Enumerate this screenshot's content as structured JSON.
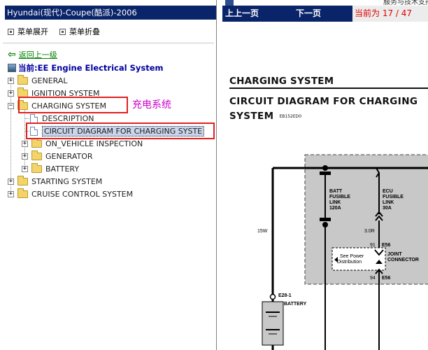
{
  "window": {
    "title": "Hyundai(现代)-Coupe(酷派)-2006"
  },
  "menu": {
    "expand_label": "菜单展开",
    "collapse_label": "菜单折叠"
  },
  "back_link": "返回上一级",
  "current_path": "当前:EE Engine Electrical System",
  "tree": {
    "general": "GENERAL",
    "ignition": "IGNITION SYSTEM",
    "charging": "CHARGING SYSTEM",
    "description": "DESCRIPTION",
    "circuit": "CIRCUIT DIAGRAM FOR CHARGING SYSTE",
    "onvehicle": "ON_VEHICLE INSPECTION",
    "generator": "GENERATOR",
    "battery": "BATTERY",
    "starting": "STARTING SYSTEM",
    "cruise": "CRUISE CONTROL SYSTEM",
    "expander_plus": "+",
    "expander_minus": "−"
  },
  "annotation": "充电系统",
  "top_band_text": "服务与技术支持中心",
  "nav": {
    "prev": "上上一页",
    "next": "下一页",
    "page_status": "当前为 17 / 47"
  },
  "doc": {
    "section_title": "CHARGING SYSTEM",
    "heading_line1": "CIRCUIT DIAGRAM FOR CHARGING",
    "heading_line2": "SYSTEM",
    "doc_code": "EB152ED0"
  },
  "diagram": {
    "batt_link": [
      "BATT",
      "FUSIBLE",
      "LINK",
      "120A"
    ],
    "ecu_link": [
      "ECU",
      "FUSIBLE",
      "LINK",
      "30A"
    ],
    "wire_15w": "15W",
    "wire_30r": "3.0R",
    "pin_91": "91",
    "e56_top": "E56",
    "joint": [
      "JOINT",
      "CONNECTOR"
    ],
    "see_power": [
      "See Power",
      "Distribution"
    ],
    "pin_94": "94",
    "e56_bottom": "E56",
    "e28": "E28-1",
    "battery": "BATTERY"
  },
  "colors": {
    "titlebar": "#0a246a",
    "annotation": "#cc00cc",
    "redbox": "#e02020",
    "back_link": "#008000",
    "current_path": "#0000a0",
    "page_status": "#e00000",
    "diagram_shade": "#c8c8c8"
  }
}
